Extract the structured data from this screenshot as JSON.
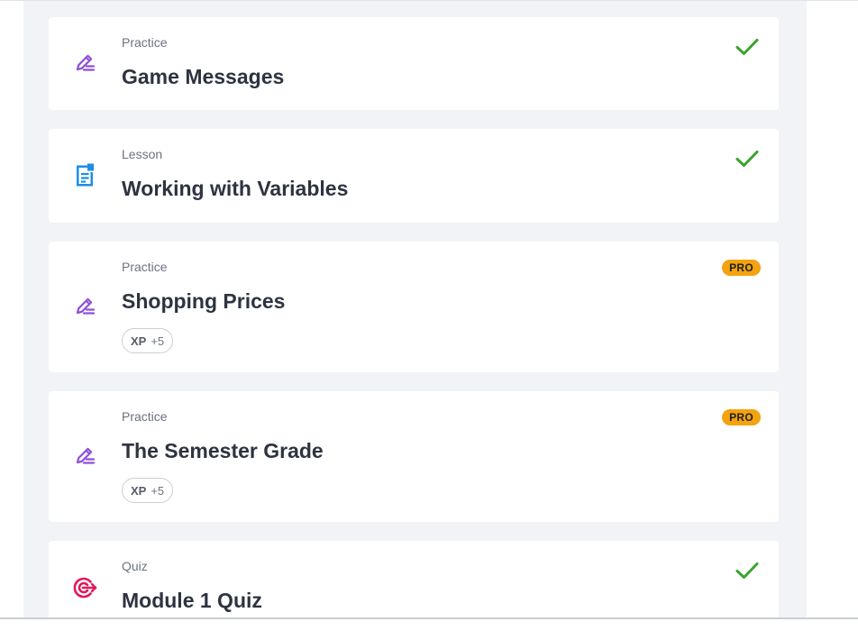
{
  "items": [
    {
      "type_label": "Practice",
      "title": "Game Messages",
      "icon": "practice-pencil-icon",
      "status": "completed"
    },
    {
      "type_label": "Lesson",
      "title": "Working with Variables",
      "icon": "lesson-document-icon",
      "status": "completed"
    },
    {
      "type_label": "Practice",
      "title": "Shopping Prices",
      "icon": "practice-pencil-icon",
      "status": "pro",
      "pro_label": "PRO",
      "xp_label": "XP",
      "xp_value": "+5"
    },
    {
      "type_label": "Practice",
      "title": "The Semester Grade",
      "icon": "practice-pencil-icon",
      "status": "pro",
      "pro_label": "PRO",
      "xp_label": "XP",
      "xp_value": "+5"
    },
    {
      "type_label": "Quiz",
      "title": "Module 1 Quiz",
      "icon": "quiz-target-icon",
      "status": "completed"
    }
  ],
  "colors": {
    "practice_icon": "#8e4fd8",
    "lesson_icon": "#1b8ee6",
    "quiz_icon": "#e3175c",
    "check": "#3aa32f",
    "pro_badge": "#f2a30f",
    "track_bg": "#f1f3f6"
  }
}
